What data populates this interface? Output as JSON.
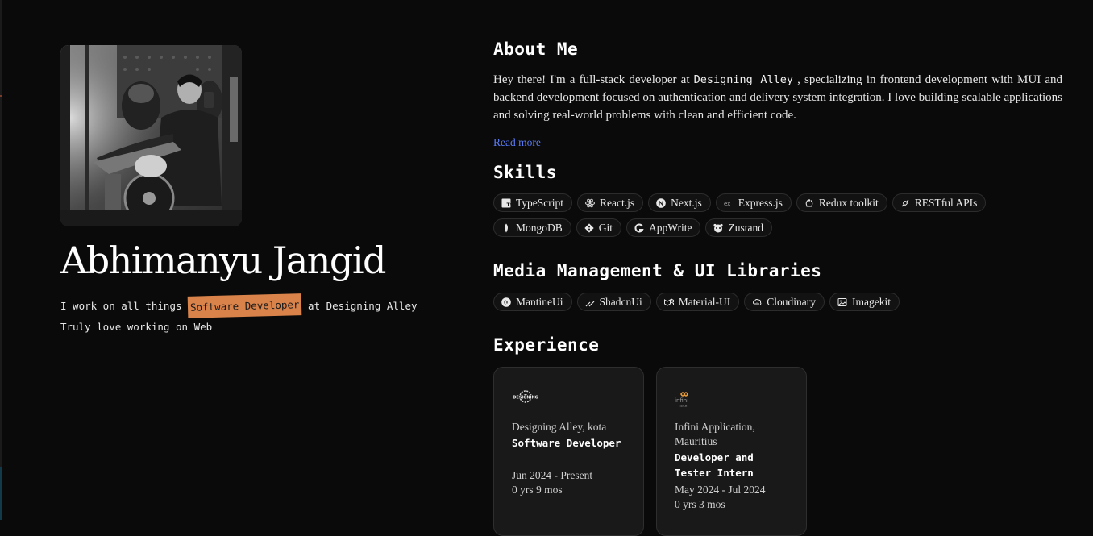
{
  "profile": {
    "name": "Abhimanyu Jangid",
    "tagline_prefix": "I work on all things",
    "tagline_highlight": "Software Developer",
    "tagline_suffix": "at Designing Alley",
    "tagline_line2": "Truly love working on Web",
    "photo_alt": "Abhimanyu Jangid"
  },
  "about": {
    "heading": "About Me",
    "text_before": "Hey there! I'm a full-stack developer at",
    "company": "Designing Alley",
    "text_after": ", specializing in frontend development with MUI and backend development focused on authentication and delivery system integration. I love building scalable applications and solving real-world problems with clean and efficient code.",
    "read_more": "Read more"
  },
  "skills": {
    "heading": "Skills",
    "row1": [
      {
        "label": "TypeScript",
        "icon": "typescript-icon"
      },
      {
        "label": "React.js",
        "icon": "react-icon"
      },
      {
        "label": "Next.js",
        "icon": "nextjs-icon"
      },
      {
        "label": "Express.js",
        "icon": "express-icon"
      },
      {
        "label": "Redux toolkit",
        "icon": "redux-icon"
      },
      {
        "label": "RESTful APIs",
        "icon": "api-icon"
      }
    ],
    "row2": [
      {
        "label": "MongoDB",
        "icon": "mongodb-icon"
      },
      {
        "label": "Git",
        "icon": "git-icon"
      },
      {
        "label": "AppWrite",
        "icon": "appwrite-icon"
      },
      {
        "label": "Zustand",
        "icon": "zustand-icon"
      }
    ]
  },
  "media": {
    "heading": "Media Management & UI Libraries",
    "items": [
      {
        "label": "MantineUi",
        "icon": "mantine-icon"
      },
      {
        "label": "ShadcnUi",
        "icon": "shadcn-icon"
      },
      {
        "label": "Material-UI",
        "icon": "mui-icon"
      },
      {
        "label": "Cloudinary",
        "icon": "cloudinary-icon"
      },
      {
        "label": "Imagekit",
        "icon": "image-icon"
      }
    ]
  },
  "experience": {
    "heading": "Experience",
    "cards": [
      {
        "logo": "designing-alley-logo",
        "logo_text": "DESIGNING",
        "company": "Designing Alley, kota",
        "role": "Software Developer",
        "dates": "Jun 2024 - Present",
        "duration": "0 yrs 9 mos"
      },
      {
        "logo": "infini-tech-logo",
        "logo_text": "infini",
        "logo_subtext": "TECH",
        "company": "Infini Application, Mauritius",
        "role": "Developer and Tester Intern",
        "dates": "May 2024 - Jul 2024",
        "duration": "0 yrs 3 mos"
      }
    ]
  },
  "colors": {
    "background": "#0a0a0a",
    "highlight": "#d9834a",
    "link": "#5b7cf7",
    "card": "#191919"
  }
}
